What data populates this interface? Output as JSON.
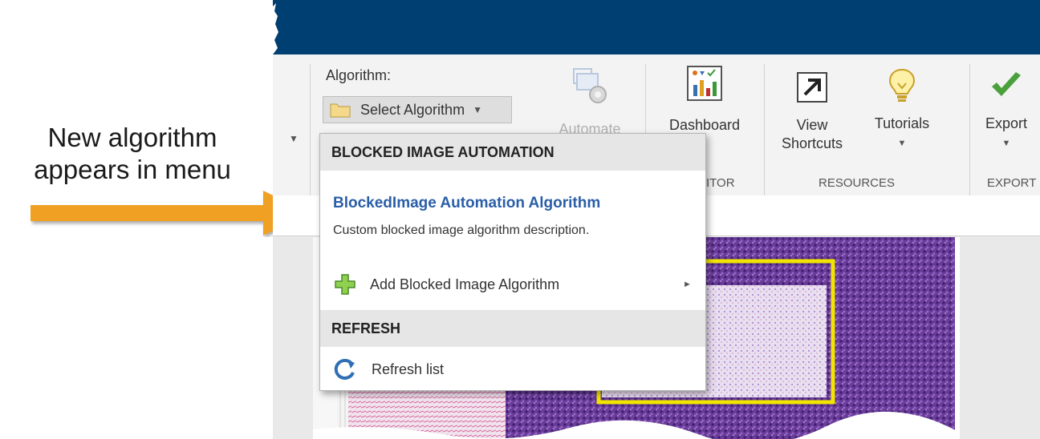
{
  "callout": {
    "line1": "New algorithm",
    "line2": "appears in menu"
  },
  "colors": {
    "titlebar": "#003f72",
    "arrow": "#f0a020",
    "menu_link": "#2a5ea8"
  },
  "toolstrip": {
    "algorithm_label": "Algorithm:",
    "select_algorithm": "Select Algorithm",
    "automate_label": "Automate",
    "dashboard_label": "Dashboard",
    "monitor_group_partial": "ITOR",
    "view_shortcuts_line1": "View",
    "view_shortcuts_line2": "Shortcuts",
    "tutorials_label": "Tutorials",
    "resources_group": "RESOURCES",
    "export_label": "Export",
    "export_group": "EXPORT"
  },
  "menu": {
    "section_automation": "BLOCKED IMAGE AUTOMATION",
    "algorithm_name": "BlockedImage Automation Algorithm",
    "algorithm_description": "Custom blocked image algorithm description.",
    "add_item": "Add Blocked Image Algorithm",
    "section_refresh": "REFRESH",
    "refresh_item": "Refresh list"
  }
}
